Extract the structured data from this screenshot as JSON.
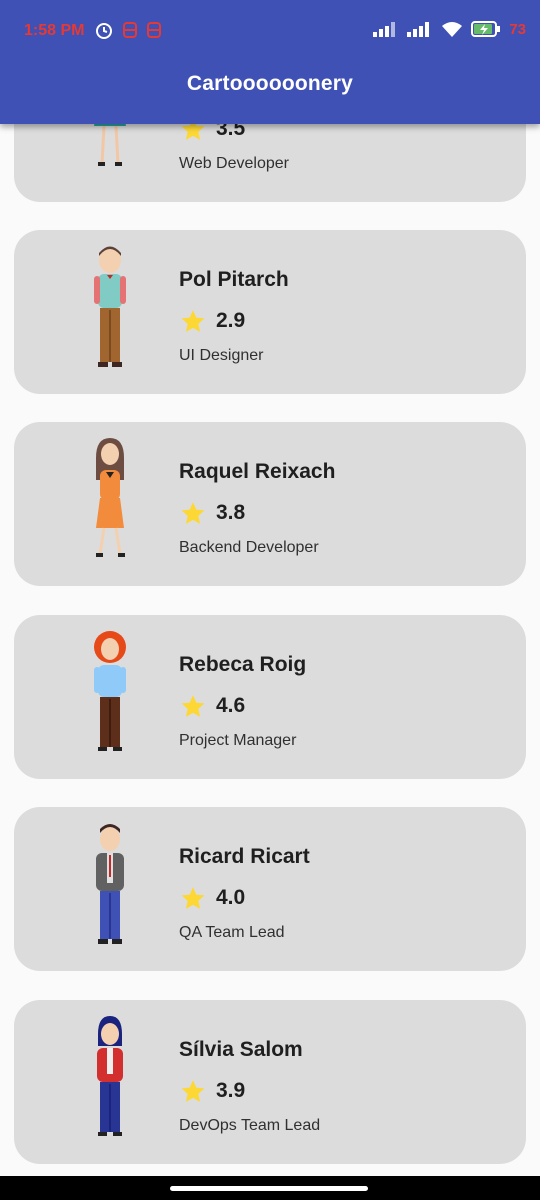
{
  "status_bar": {
    "time": "1:58 PM",
    "battery_percent": "73"
  },
  "app_bar": {
    "title": "Cartoooooonery"
  },
  "colors": {
    "app_bar": "#3f51b5",
    "card": "#dcdcdc",
    "star": "#fdd835",
    "status_text": "#e53935"
  },
  "people": [
    {
      "name": "",
      "rating": "3.5",
      "role": "Web Developer",
      "icon": "female-avatar-teal-dress"
    },
    {
      "name": "Pol Pitarch",
      "rating": "2.9",
      "role": "UI Designer",
      "icon": "male-avatar-plaid-vest"
    },
    {
      "name": "Raquel Reixach",
      "rating": "3.8",
      "role": "Backend Developer",
      "icon": "female-avatar-orange-dress"
    },
    {
      "name": "Rebeca Roig",
      "rating": "4.6",
      "role": "Project Manager",
      "icon": "female-avatar-red-hair"
    },
    {
      "name": "Ricard Ricart",
      "rating": "4.0",
      "role": "QA Team Lead",
      "icon": "male-avatar-suit"
    },
    {
      "name": "Sílvia Salom",
      "rating": "3.9",
      "role": "DevOps Team Lead",
      "icon": "female-avatar-red-jacket"
    }
  ]
}
